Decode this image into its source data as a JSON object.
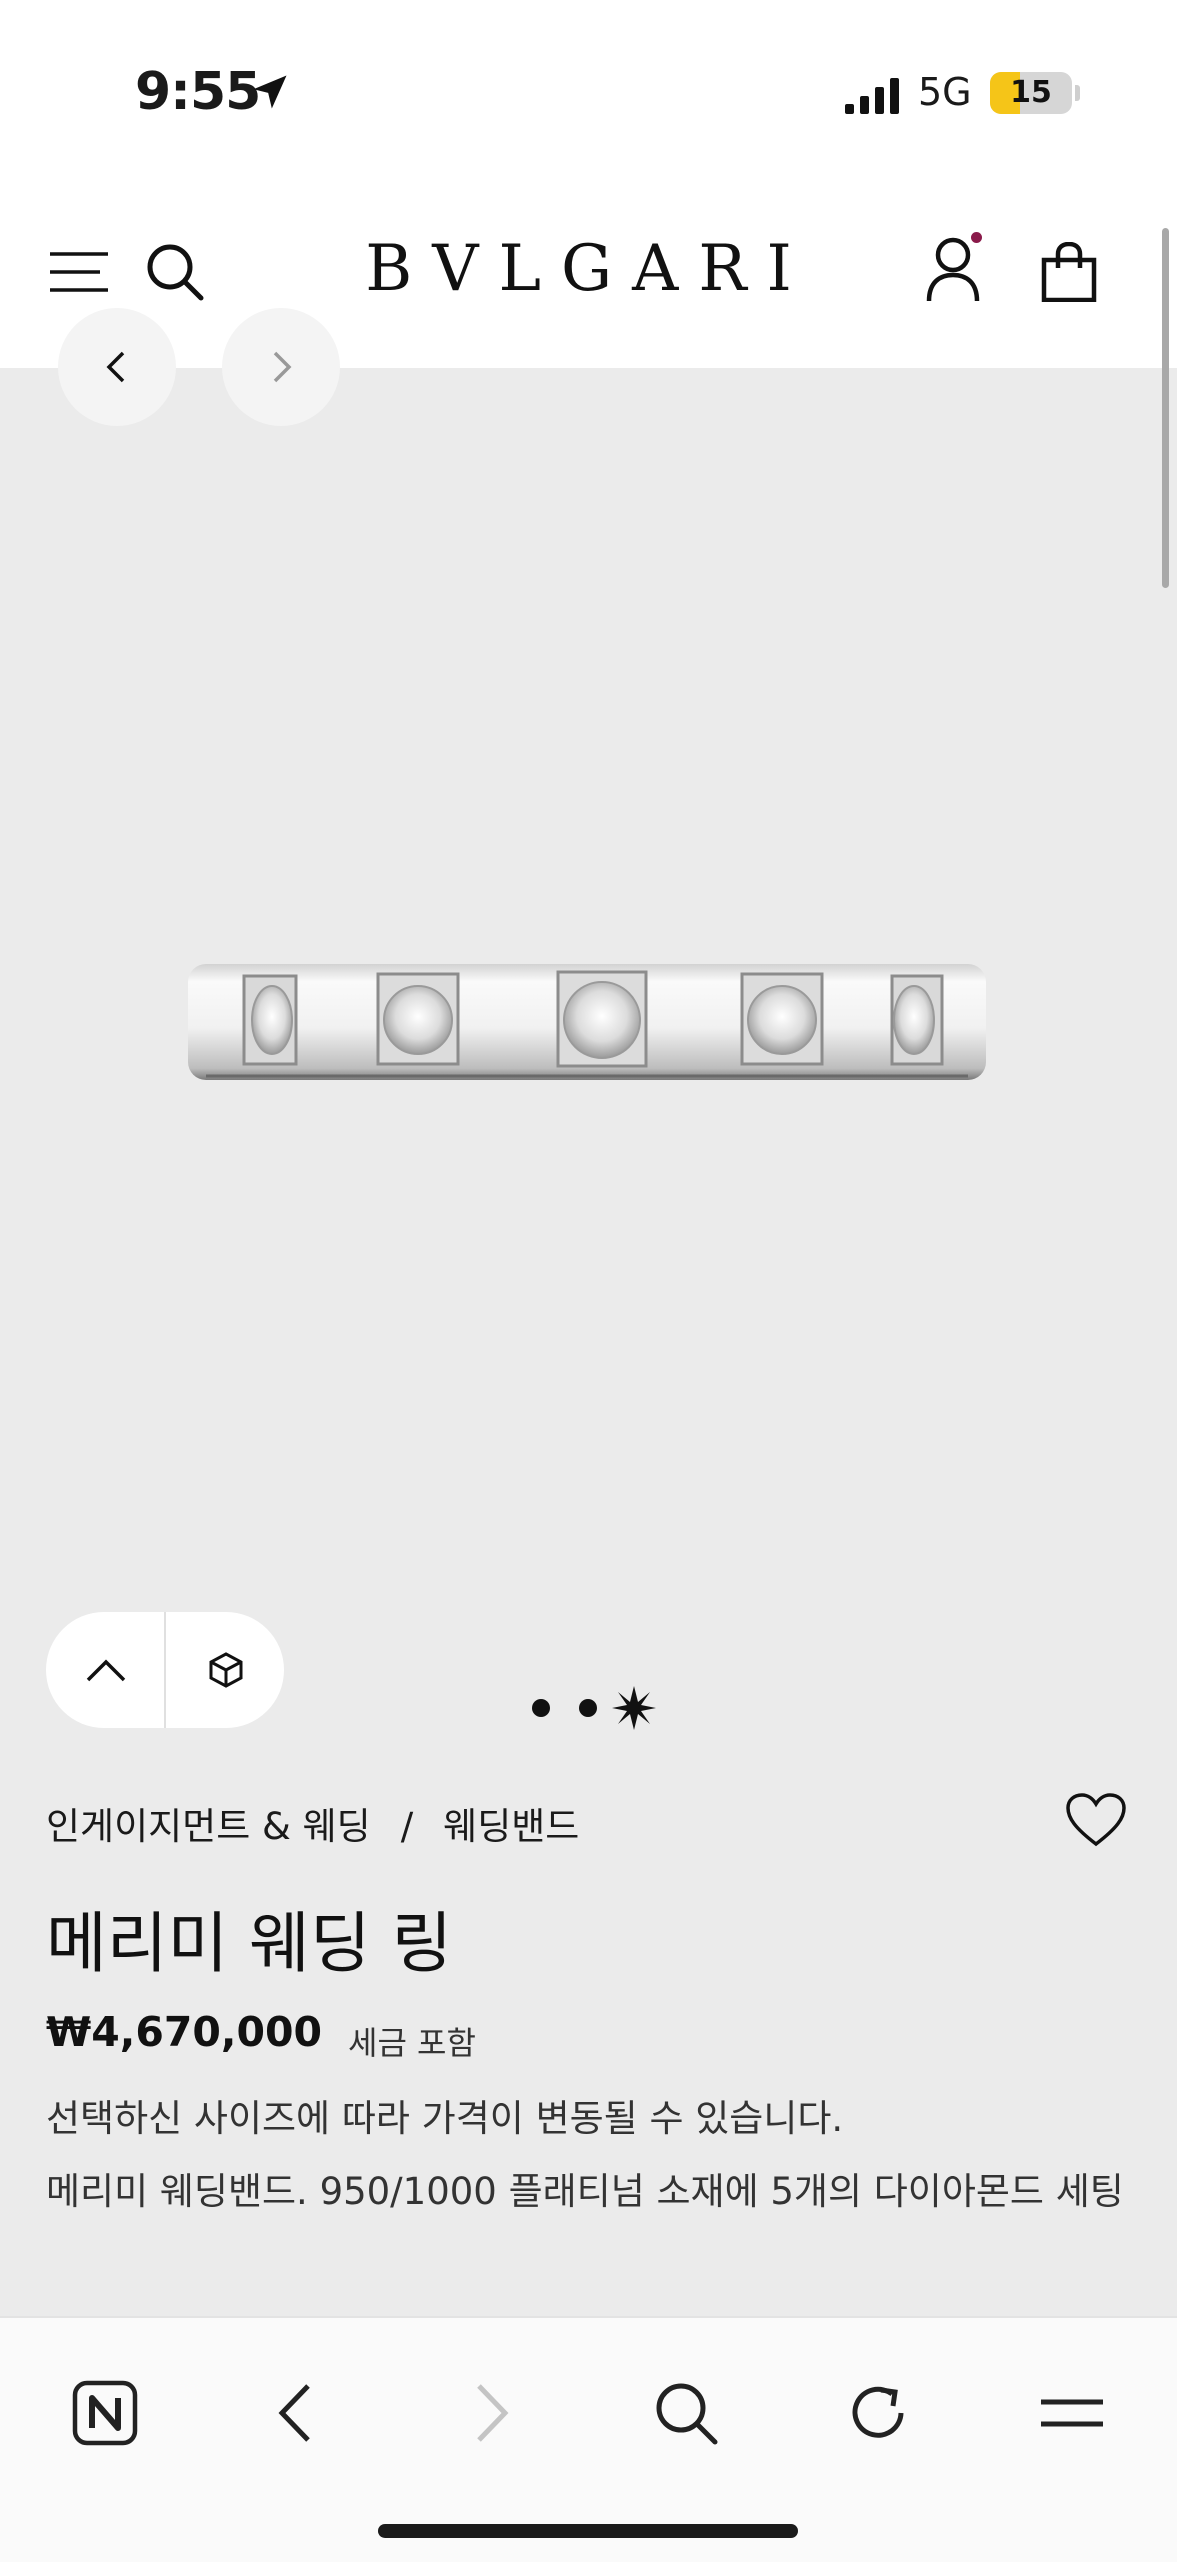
{
  "status_bar": {
    "time": "9:55",
    "network": "5G",
    "battery": "15",
    "icons": [
      "location-arrow-icon",
      "signal-icon",
      "battery-icon"
    ]
  },
  "header": {
    "brand": "BVLGARI",
    "icons": [
      "menu-icon",
      "search-icon",
      "account-icon",
      "shopping-bag-icon"
    ]
  },
  "gallery": {
    "page_count": 3,
    "active_index": 2,
    "nav_icons": [
      "chevron-left-icon",
      "chevron-right-icon"
    ],
    "control_icons": [
      "chevron-up-icon",
      "cube-3d-icon"
    ]
  },
  "product": {
    "breadcrumb": {
      "category": "인게이지먼트 & 웨딩",
      "separator": "/",
      "subcategory": "웨딩밴드"
    },
    "title": "메리미 웨딩 링",
    "price": "₩4,670,000",
    "tax_note": "세금 포함",
    "price_note": "선택하신 사이즈에 따라 가격이 변동될 수 있습니다.",
    "description": "메리미 웨딩밴드. 950/1000 플래티넘 소재에 5개의 다이아몬드 세팅"
  },
  "browser_toolbar": {
    "icons": [
      "naver-home-icon",
      "back-icon",
      "forward-icon",
      "search-icon",
      "reload-icon",
      "menu-icon"
    ]
  },
  "colors": {
    "accent_dot": "#8a1a4a",
    "battery_low": "#f5c518",
    "page_background": "#ebebeb"
  }
}
